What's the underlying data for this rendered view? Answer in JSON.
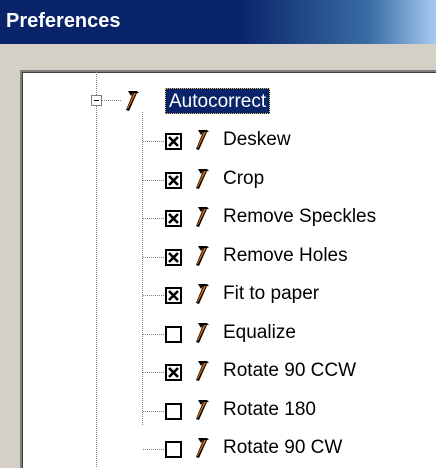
{
  "window": {
    "title": "Preferences"
  },
  "tree": {
    "root": {
      "label": "Autocorrect",
      "expanded": true,
      "icon": "hammer-icon"
    },
    "items": [
      {
        "label": "Deskew",
        "checked": true,
        "icon": "hammer-icon"
      },
      {
        "label": "Crop",
        "checked": true,
        "icon": "hammer-icon"
      },
      {
        "label": "Remove Speckles",
        "checked": true,
        "icon": "hammer-icon"
      },
      {
        "label": "Remove Holes",
        "checked": true,
        "icon": "hammer-icon"
      },
      {
        "label": "Fit to paper",
        "checked": true,
        "icon": "hammer-icon"
      },
      {
        "label": "Equalize",
        "checked": false,
        "icon": "hammer-icon"
      },
      {
        "label": "Rotate 90 CCW",
        "checked": true,
        "icon": "hammer-icon"
      },
      {
        "label": "Rotate 180",
        "checked": false,
        "icon": "hammer-icon"
      },
      {
        "label": "Rotate 90 CW",
        "checked": false,
        "icon": "hammer-icon"
      }
    ]
  },
  "colors": {
    "title_bar": "#0a246a",
    "selection": "#0a246a",
    "panel_bg": "#ffffff",
    "chrome_bg": "#d4d0c8"
  }
}
